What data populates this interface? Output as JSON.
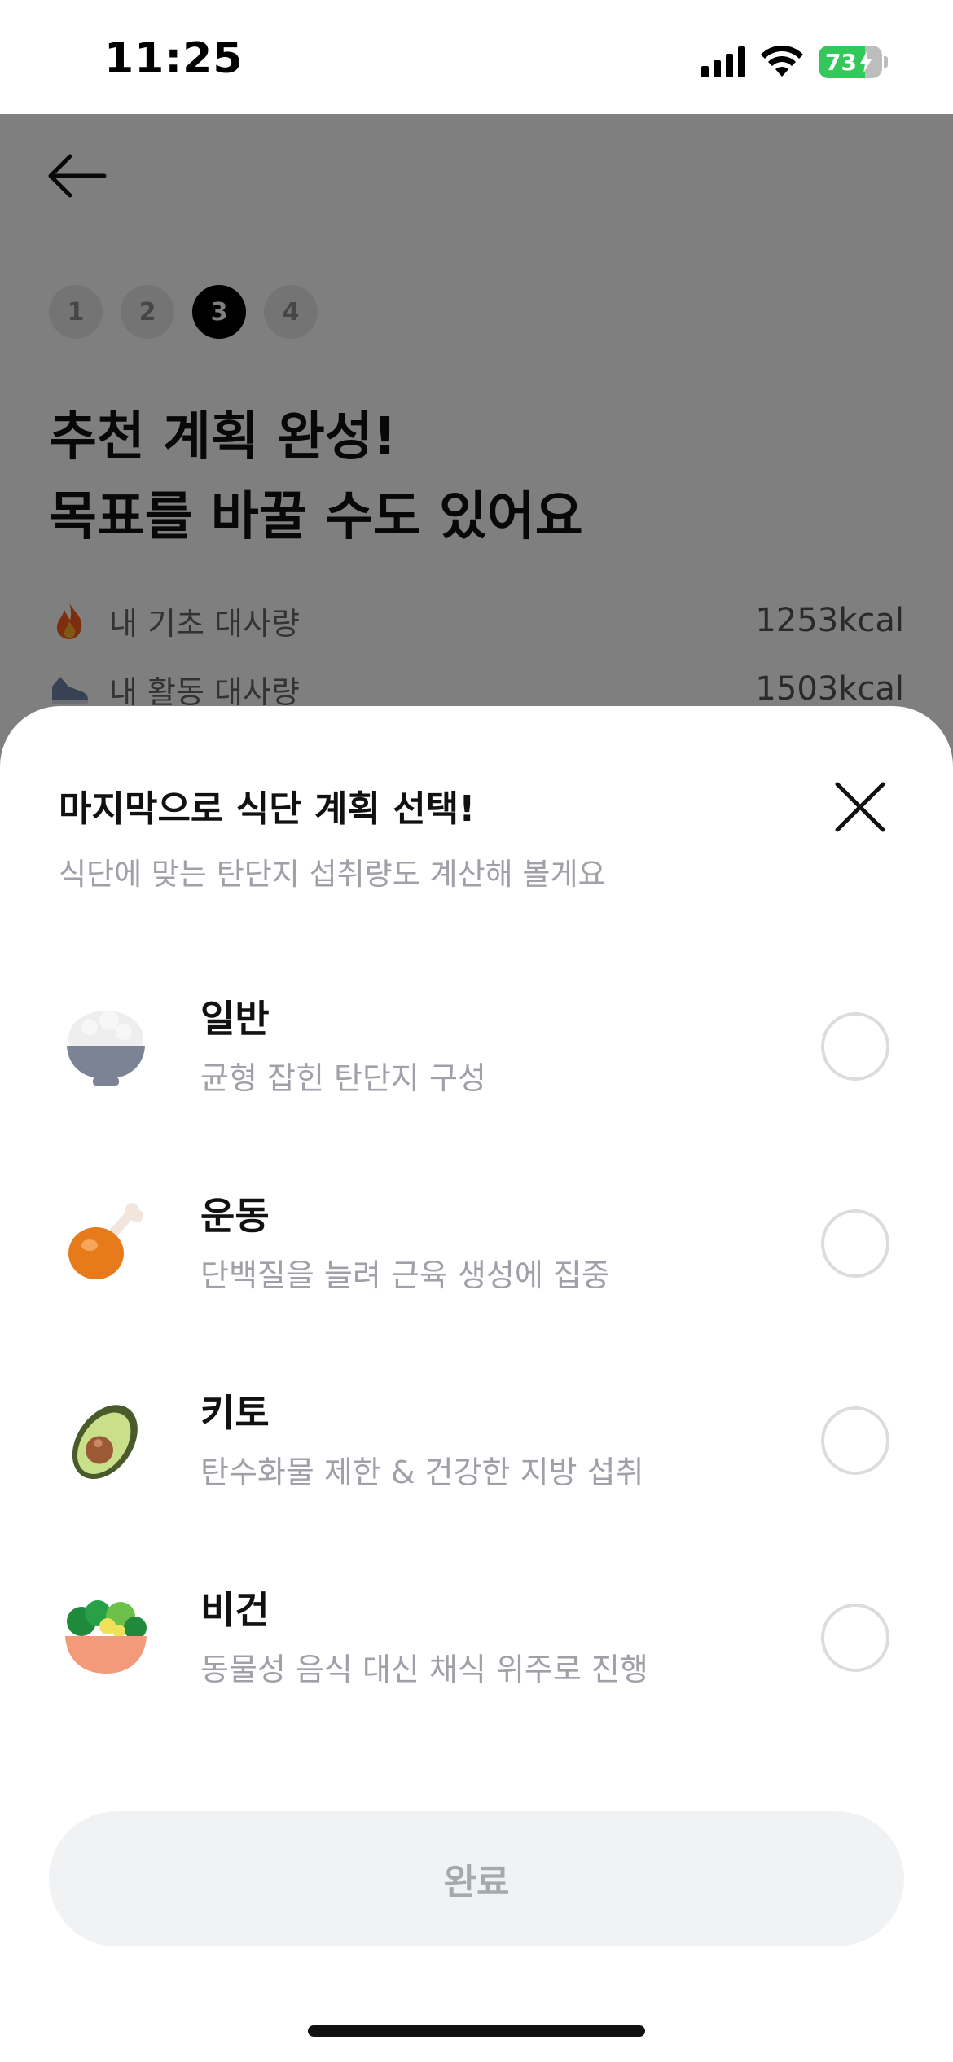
{
  "status_bar": {
    "time": "11:25",
    "battery_text": "73",
    "battery_level": 0.73,
    "icons": [
      "signal-icon",
      "wifi-icon",
      "battery-charging-icon"
    ]
  },
  "background": {
    "back_icon": "arrow-left-icon",
    "steps": [
      {
        "label": "1",
        "active": false
      },
      {
        "label": "2",
        "active": false
      },
      {
        "label": "3",
        "active": true
      },
      {
        "label": "4",
        "active": false
      }
    ],
    "headline_lines": [
      "추천 계획 완성!",
      "목표를 바꿀 수도 있어요"
    ],
    "metrics": [
      {
        "icon": "flame-icon",
        "label": "내 기초 대사량",
        "value": "1253kcal"
      },
      {
        "icon": "sneaker-icon",
        "label": "내 활동 대사량",
        "value": "1503kcal"
      }
    ]
  },
  "sheet": {
    "title": "마지막으로 식단 계획 선택!",
    "subtitle": "식단에 맞는 탄단지 섭취량도 계산해 볼게요",
    "close_icon": "close-icon",
    "options": [
      {
        "icon": "rice-bowl-icon",
        "title": "일반",
        "desc": "균형 잡힌 탄단지 구성",
        "selected": false
      },
      {
        "icon": "chicken-leg-icon",
        "title": "운동",
        "desc": "단백질을 늘려 근육 생성에 집중",
        "selected": false
      },
      {
        "icon": "avocado-icon",
        "title": "키토",
        "desc": "탄수화물 제한 & 건강한 지방 섭취",
        "selected": false
      },
      {
        "icon": "salad-bowl-icon",
        "title": "비건",
        "desc": "동물성 음식 대신 채식 위주로 진행",
        "selected": false
      }
    ],
    "done_label": "완료"
  },
  "colors": {
    "overlay": "#000000",
    "active_step": "#000000",
    "radio_border": "#dcdcdc",
    "done_bg": "#f1f2f4",
    "done_text": "#a6a8ae",
    "battery_green": "#34c759"
  }
}
